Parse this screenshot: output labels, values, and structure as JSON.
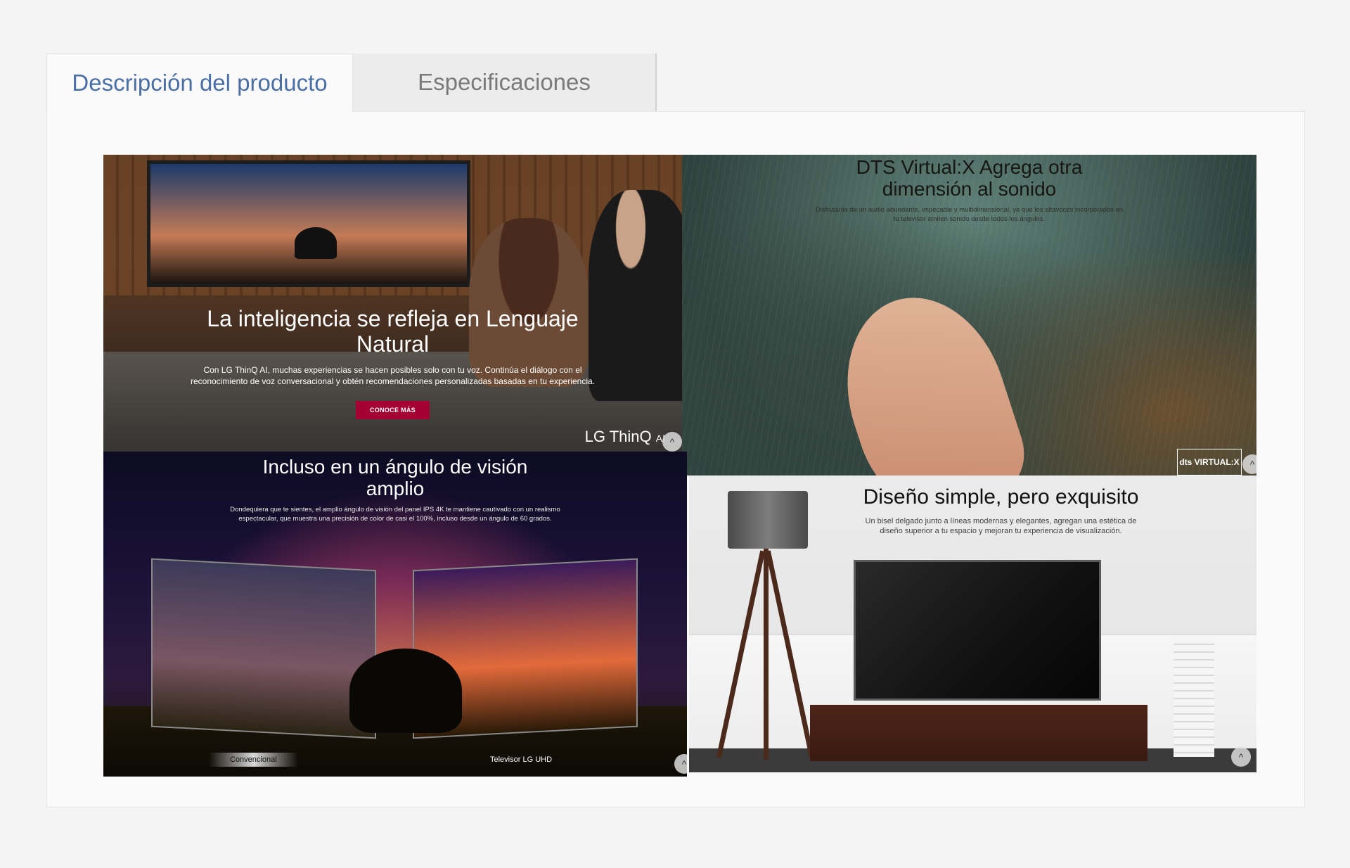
{
  "tabs": {
    "description_label": "Descripción del producto",
    "specs_label": "Especificaciones"
  },
  "tiles": {
    "thinq": {
      "heading": "La inteligencia se refleja en Lenguaje Natural",
      "body": "Con LG ThinQ AI, muchas experiencias se hacen posibles solo con tu voz. Continúa el diálogo con el reconocimiento de voz conversacional y obtén recomendaciones personalizadas basadas en tu experiencia.",
      "cta": "CONOCE MÁS",
      "logo_main": "LG ThinQ",
      "logo_suffix": "AI"
    },
    "dts": {
      "heading": "DTS Virtual:X Agrega otra dimensión al sonido",
      "body": "Disfrutarás de un audio abundante, impecable y multidimensional, ya que los altavoces incorporados en tu televisor emiten sonido desde todos los ángulos.",
      "badge": "dts VIRTUAL:X"
    },
    "angle": {
      "heading": "Incluso en un ángulo de visión amplio",
      "body": "Dondequiera que te sientes, el amplio ángulo de visión del panel IPS 4K te mantiene cautivado con un realismo espectacular, que muestra una precisión de color de casi el 100%, incluso desde un ángulo de 60 grados.",
      "label_left": "Convencional",
      "label_right": "Televisor LG UHD"
    },
    "design": {
      "heading": "Diseño simple, pero exquisito",
      "body": "Un bisel delgado junto a líneas modernas y elegantes, agregan una estética de diseño superior a tu espacio y mejoran tu experiencia de visualización."
    }
  },
  "colors": {
    "active_tab_text": "#4a6fa5",
    "inactive_tab_text": "#7a7a7a",
    "cta_bg": "#a50034"
  }
}
